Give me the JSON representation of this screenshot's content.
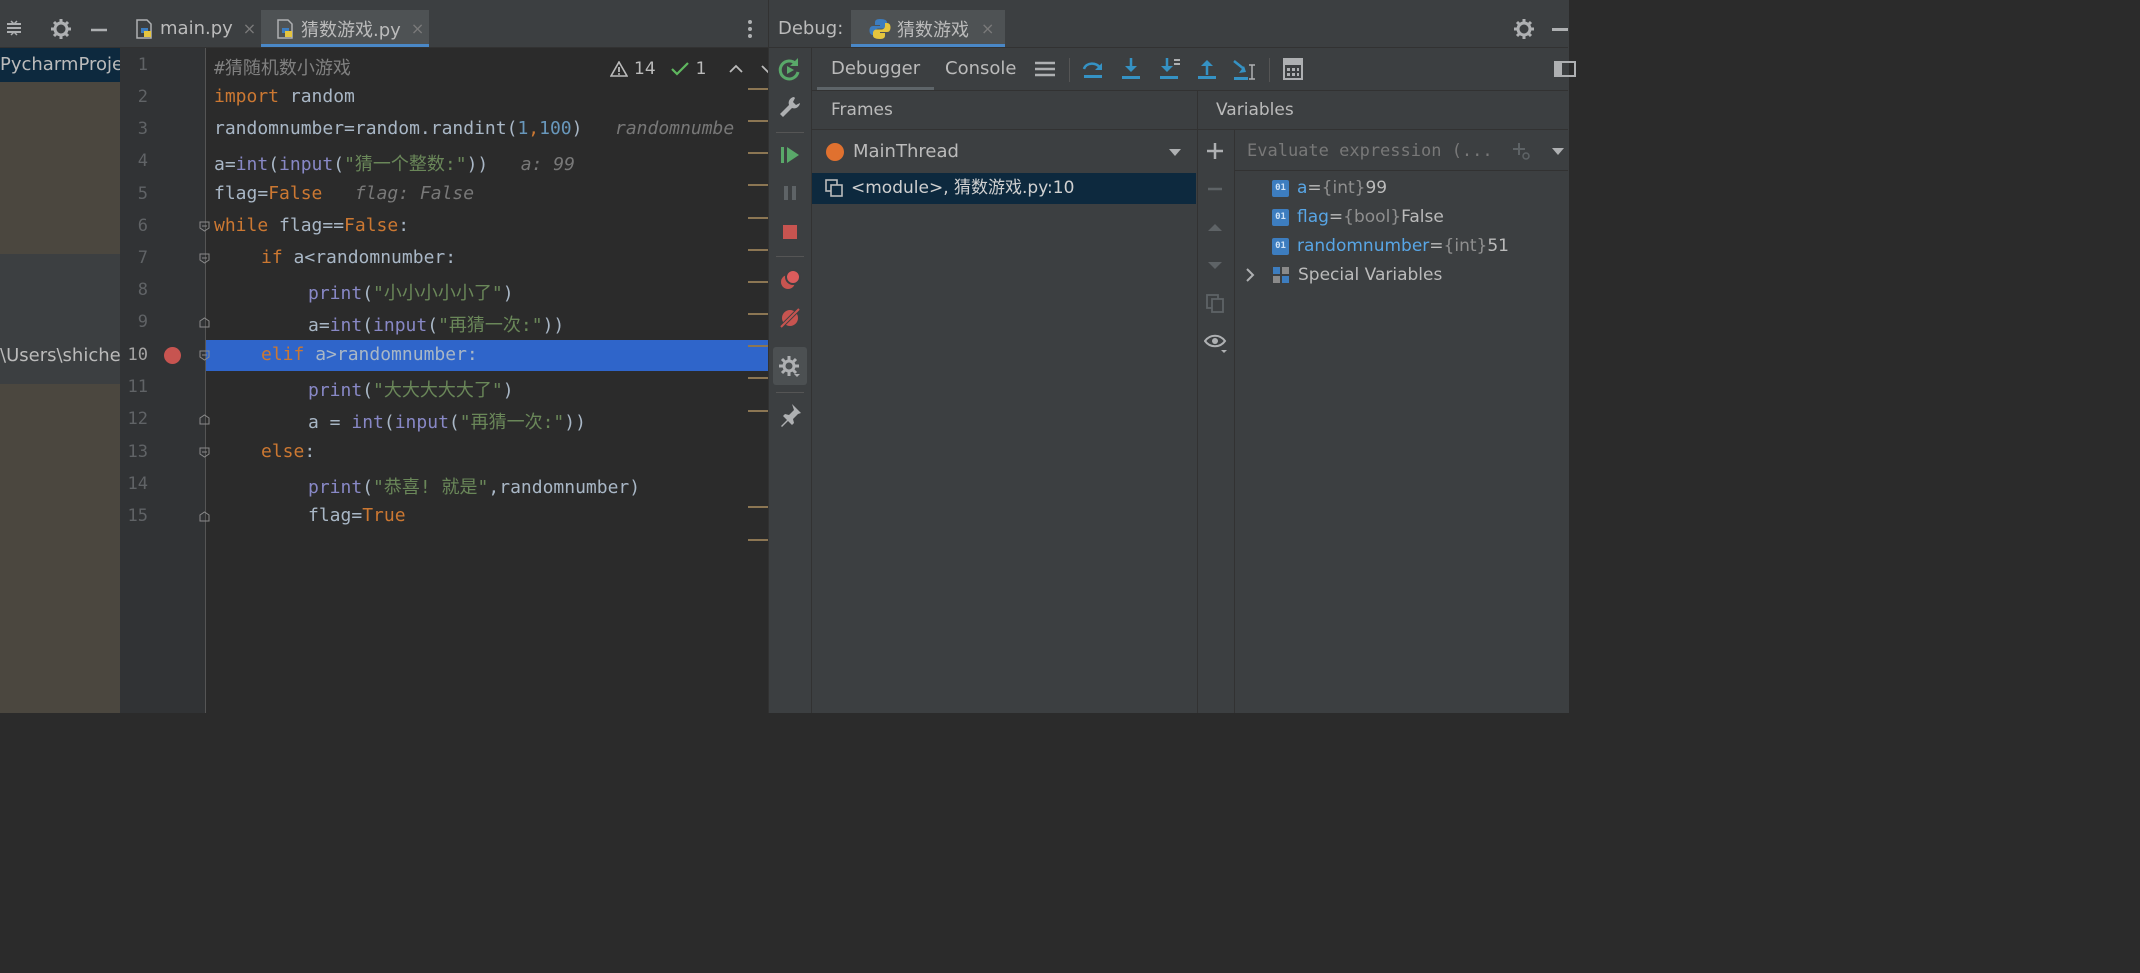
{
  "project": {
    "name": "PycharmProjec",
    "path": "\\Users\\shichen"
  },
  "editor": {
    "tabs": [
      {
        "label": "main.py",
        "close": "×"
      },
      {
        "label": "猜数游戏.py",
        "close": "×"
      }
    ],
    "inspection": {
      "warnings": "14",
      "ok": "1"
    },
    "lines": [
      "1",
      "2",
      "3",
      "4",
      "5",
      "6",
      "7",
      "8",
      "9",
      "10",
      "11",
      "12",
      "13",
      "14",
      "15"
    ],
    "code": {
      "l1": {
        "comment": "#猜随机数小游戏"
      },
      "l2": {
        "kw": "import",
        "rest": " random"
      },
      "l3": {
        "a": "randomnumber=random.randint(",
        "n1": "1",
        "c": ",",
        "n2": "100",
        "b": ")",
        "hint": "randomnumbe"
      },
      "l4": {
        "a": "a=",
        "f1": "int",
        "p1": "(",
        "f2": "input",
        "p2": "(",
        "s": "\"猜一个整数:\"",
        "p3": "))",
        "hint": "a: 99"
      },
      "l5": {
        "a": "flag=",
        "kw": "False",
        "hint": "flag: False"
      },
      "l6": {
        "kw": "while",
        "a": " flag==",
        "kw2": "False",
        "b": ":"
      },
      "l7": {
        "kw": "if",
        "a": " a<randomnumber:"
      },
      "l8": {
        "f": "print",
        "p1": "(",
        "s": "\"小小小小小了\"",
        "p2": ")"
      },
      "l9": {
        "a": "a=",
        "f1": "int",
        "p1": "(",
        "f2": "input",
        "p2": "(",
        "s": "\"再猜一次:\"",
        "p3": "))"
      },
      "l10": {
        "kw": "elif",
        "a": " a>randomnumber:"
      },
      "l11": {
        "f": "print",
        "p1": "(",
        "s": "\"大大大大大了\"",
        "p2": ")"
      },
      "l12": {
        "a": "a = ",
        "f1": "int",
        "p1": "(",
        "f2": "input",
        "p2": "(",
        "s": "\"再猜一次:\"",
        "p3": "))"
      },
      "l13": {
        "kw": "else",
        "a": ":"
      },
      "l14": {
        "f": "print",
        "p1": "(",
        "s": "\"恭喜! 就是\"",
        "a": ",randomnumber)"
      },
      "l15": {
        "a": "flag=",
        "kw": "True"
      }
    }
  },
  "debug": {
    "label": "Debug:",
    "tab": {
      "label": "猜数游戏",
      "close": "×"
    },
    "subtabs": {
      "debugger": "Debugger",
      "console": "Console"
    },
    "frames": {
      "title": "Frames",
      "thread": "MainThread",
      "frame": "<module>, 猜数游戏.py:10"
    },
    "variables": {
      "title": "Variables",
      "eval_placeholder": "Evaluate expression (...",
      "items": [
        {
          "name": "a",
          "eq": " = ",
          "type": "{int}",
          "value": " 99"
        },
        {
          "name": "flag",
          "eq": " = ",
          "type": "{bool}",
          "value": " False"
        },
        {
          "name": "randomnumber",
          "eq": " = ",
          "type": "{int}",
          "value": " 51"
        }
      ],
      "special": "Special Variables"
    }
  },
  "colors": {
    "keyword": "#cc7832",
    "string": "#6a8759",
    "number": "#6897bb",
    "builtin": "#8888c6",
    "selection": "#2f65ca",
    "breakpoint": "#c75450"
  }
}
